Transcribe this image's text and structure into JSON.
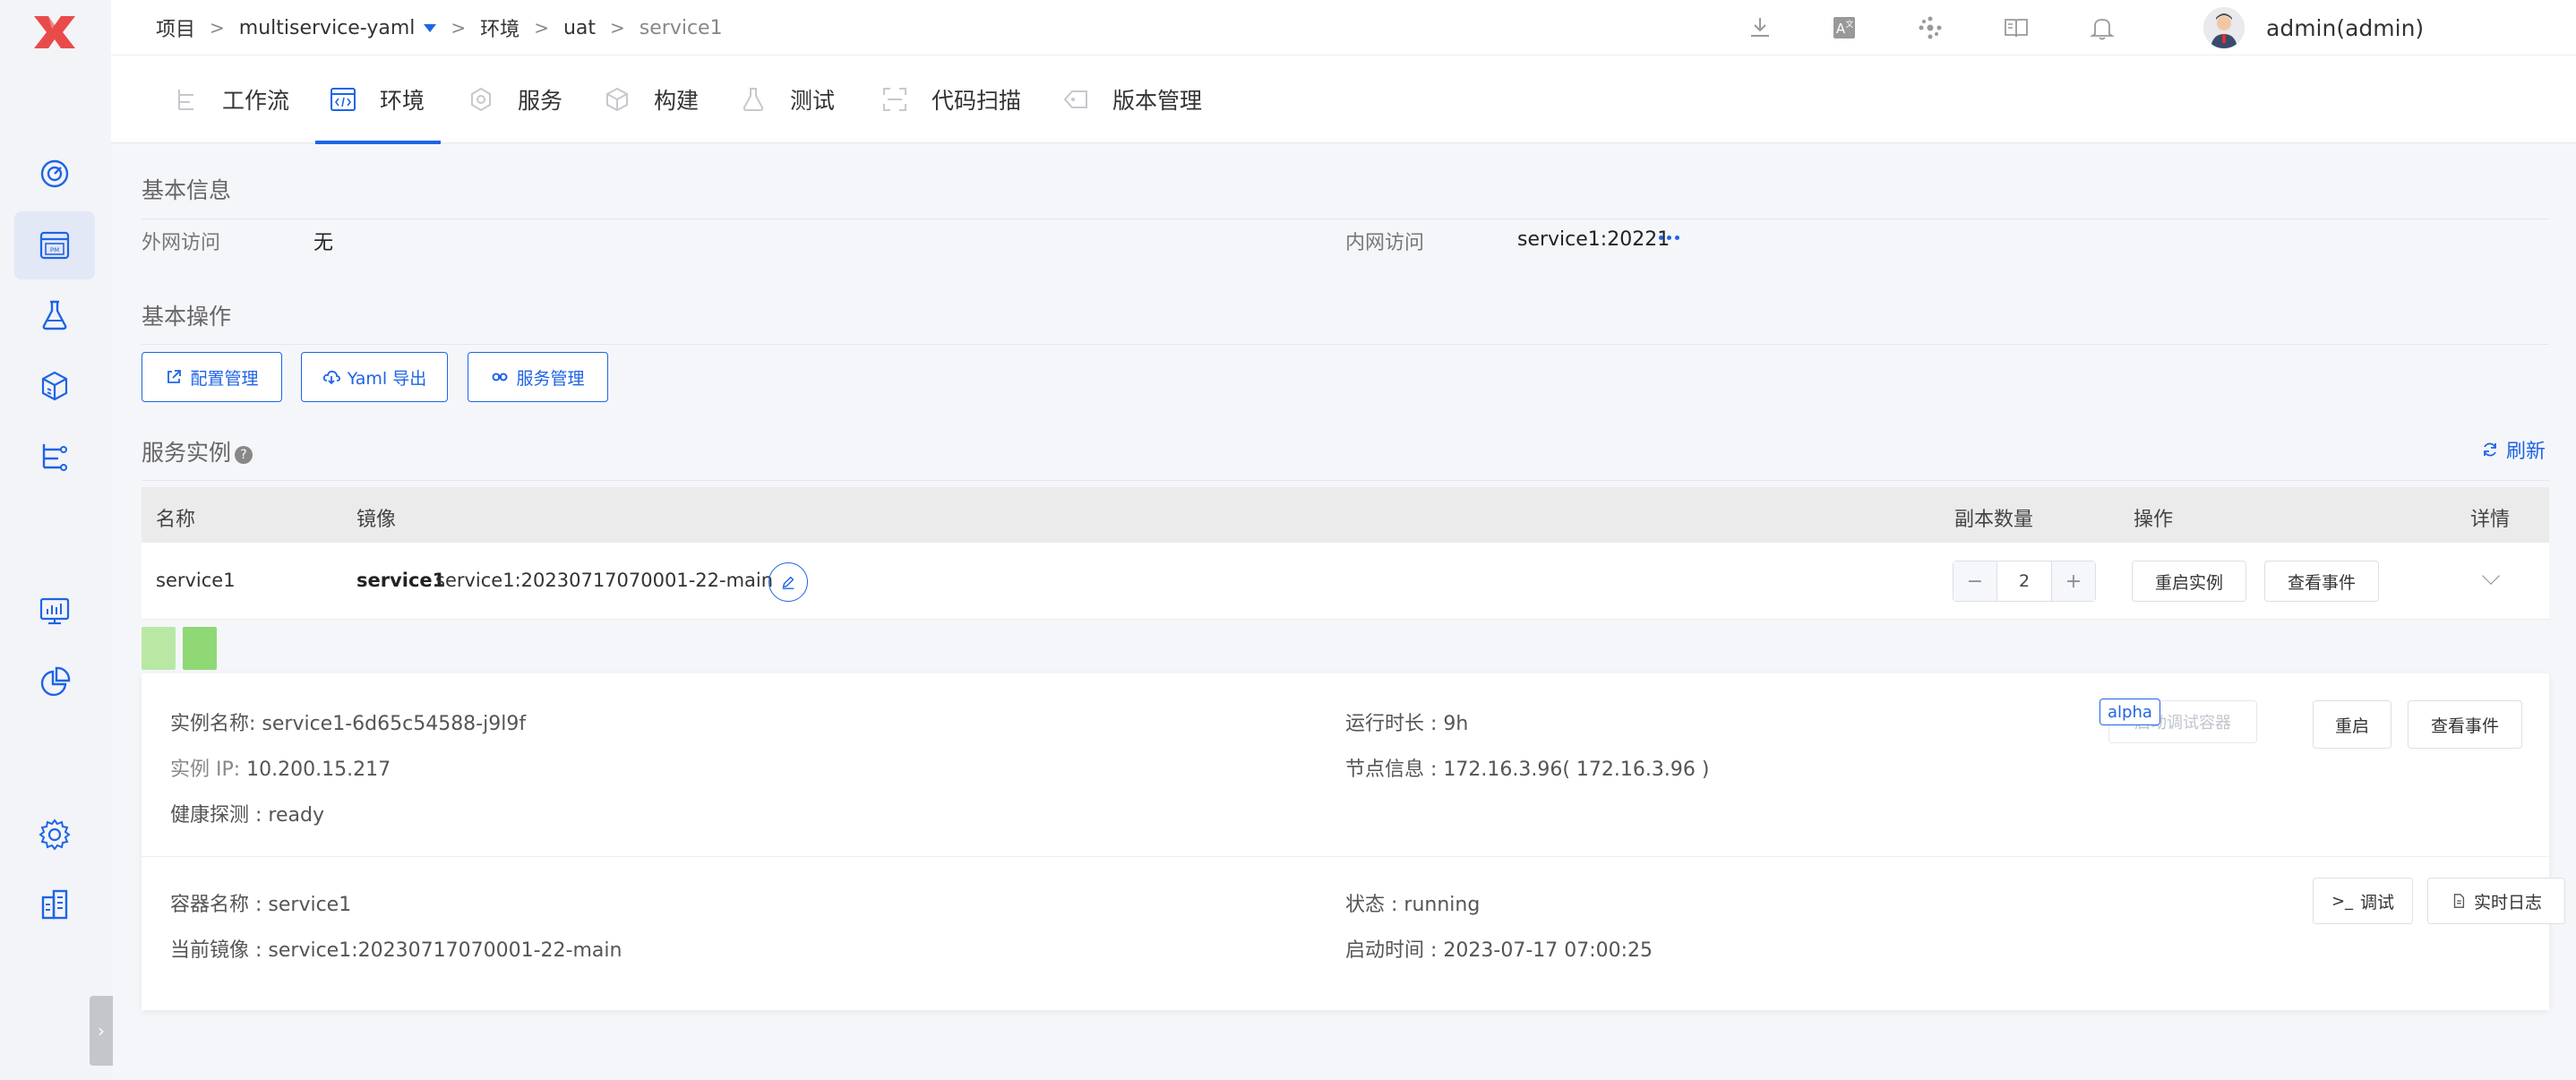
{
  "colors": {
    "accent": "#1e64e6",
    "brand_logo": "#e94b4b",
    "pod_light": "#b9e8a4",
    "pod_green": "#8fd875"
  },
  "breadcrumb": {
    "project": "项目",
    "project_name": "multiservice-yaml",
    "env_label": "环境",
    "env_name": "uat",
    "service": "service1",
    "separator": ">"
  },
  "header_icons": [
    "download-icon",
    "translate-icon",
    "dots-cluster-icon",
    "book-icon",
    "bell-icon"
  ],
  "user": {
    "name": "admin(admin)"
  },
  "leftnav": [
    "dashboard-icon",
    "project-icon",
    "flask-icon",
    "package-icon",
    "workflow-icon",
    "monitor-icon",
    "chart-icon",
    "settings-icon",
    "building-icon"
  ],
  "tabs": [
    {
      "label": "工作流",
      "icon": "workflow-icon"
    },
    {
      "label": "环境",
      "icon": "code-icon",
      "active": true
    },
    {
      "label": "服务",
      "icon": "hexagon-icon"
    },
    {
      "label": "构建",
      "icon": "cube-icon"
    },
    {
      "label": "测试",
      "icon": "flask-icon"
    },
    {
      "label": "代码扫描",
      "icon": "scan-icon"
    },
    {
      "label": "版本管理",
      "icon": "tag-icon"
    }
  ],
  "basic_info": {
    "title": "基本信息",
    "external_label": "外网访问",
    "external_value": "无",
    "internal_label": "内网访问",
    "internal_value": "service1:20221"
  },
  "basic_ops": {
    "title": "基本操作",
    "config_button": "配置管理",
    "yaml_button": "Yaml 导出",
    "service_button": "服务管理"
  },
  "instances": {
    "title": "服务实例",
    "refresh": "刷新",
    "columns": {
      "name": "名称",
      "image": "镜像",
      "replicas": "副本数量",
      "actions": "操作",
      "details": "详情"
    },
    "row": {
      "name": "service1",
      "image_service": "service1",
      "image_tag": "service1:20230717070001-22-main",
      "replicas": "2",
      "restart_button": "重启实例",
      "events_button": "查看事件"
    }
  },
  "pod": {
    "instance_name": "实例名称: service1-6d65c54588-j9l9f",
    "instance_ip_label": "实例 IP:",
    "instance_ip": "10.200.15.217",
    "health": "健康探测 : ready",
    "uptime": "运行时长 : 9h",
    "node": "节点信息 : 172.16.3.96( 172.16.3.96 )",
    "debug_container_button": "启动调试容器",
    "alpha_tag": "alpha",
    "restart_button": "重启",
    "events_button": "查看事件"
  },
  "container": {
    "name": "容器名称 : service1",
    "image": "当前镜像 : service1:20230717070001-22-main",
    "status": "状态 : running",
    "start_time": "启动时间 : 2023-07-17 07:00:25",
    "debug_button": "调试",
    "logs_button": "实时日志"
  }
}
